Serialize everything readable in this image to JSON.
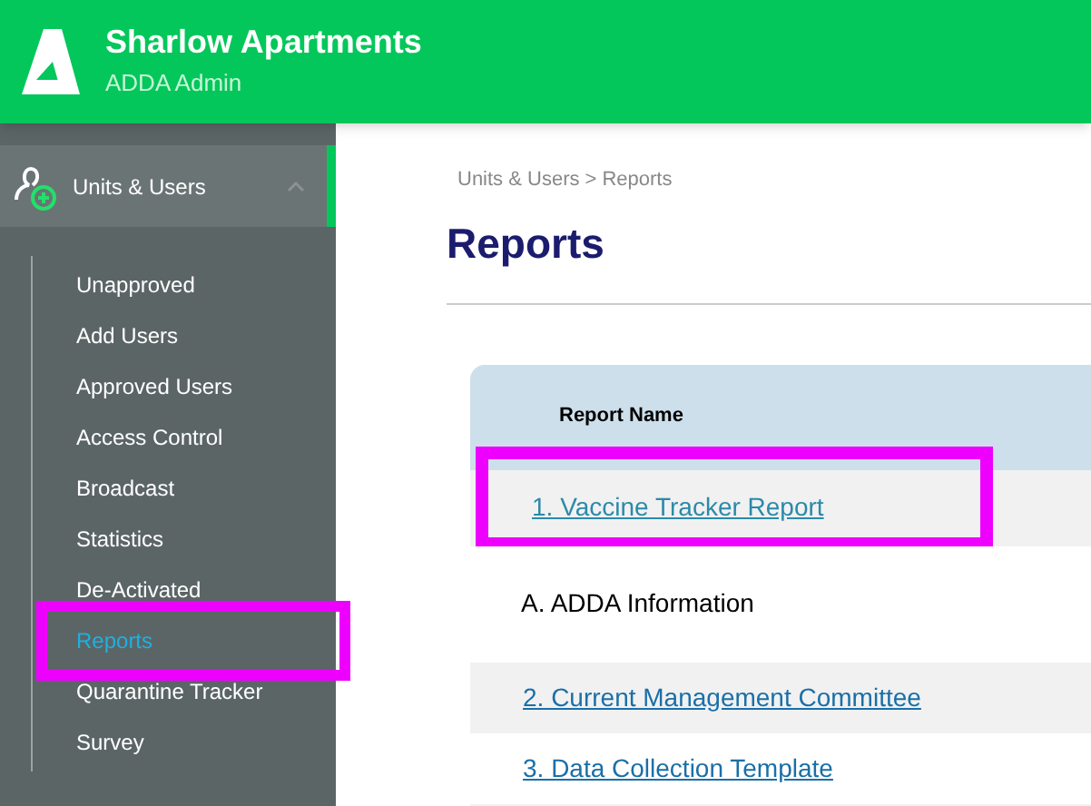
{
  "header": {
    "title": "Sharlow Apartments",
    "subtitle": "ADDA Admin"
  },
  "sidebar": {
    "section": {
      "label": "Units & Users",
      "expanded": true,
      "selected": true
    },
    "items": [
      {
        "label": "Unapproved",
        "selected": false,
        "highlighted": false
      },
      {
        "label": "Add Users",
        "selected": false,
        "highlighted": false
      },
      {
        "label": "Approved Users",
        "selected": false,
        "highlighted": false
      },
      {
        "label": "Access Control",
        "selected": false,
        "highlighted": false
      },
      {
        "label": "Broadcast",
        "selected": false,
        "highlighted": false
      },
      {
        "label": "Statistics",
        "selected": false,
        "highlighted": false
      },
      {
        "label": "De-Activated",
        "selected": false,
        "highlighted": false
      },
      {
        "label": "Reports",
        "selected": true,
        "highlighted": true
      },
      {
        "label": "Quarantine Tracker",
        "selected": false,
        "highlighted": false
      },
      {
        "label": "Survey",
        "selected": false,
        "highlighted": false
      }
    ]
  },
  "breadcrumb": [
    "Units & Users",
    "Reports"
  ],
  "breadcrumb_separator": ">",
  "page_title": "Reports",
  "table": {
    "columns": [
      "Report Name"
    ],
    "rows": [
      {
        "kind": "link",
        "text": "1. Vaccine Tracker Report",
        "highlighted": true
      },
      {
        "kind": "heading",
        "text": "A. ADDA Information",
        "highlighted": false
      },
      {
        "kind": "link",
        "text": "2. Current Management Committee",
        "highlighted": false
      },
      {
        "kind": "link",
        "text": "3. Data Collection Template",
        "highlighted": false
      }
    ]
  }
}
